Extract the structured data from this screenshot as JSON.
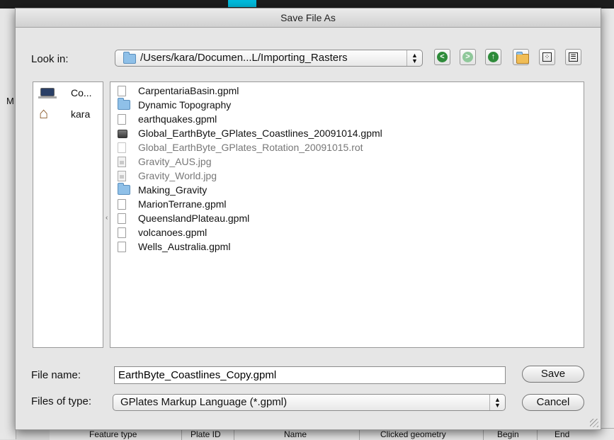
{
  "dialog": {
    "title": "Save File As",
    "look_in_label": "Look in:",
    "look_in_path": "/Users/kara/Documen...L/Importing_Rasters",
    "toolbar": [
      {
        "name": "back-icon",
        "color": "#2e8b3a"
      },
      {
        "name": "forward-icon",
        "color": "#8fc89a"
      },
      {
        "name": "up-folder-icon",
        "color": "#2e8b3a"
      },
      {
        "name": "new-folder-icon",
        "color": "#e0a23a"
      },
      {
        "name": "list-view-icon",
        "color": "#333333"
      },
      {
        "name": "details-view-icon",
        "color": "#333333"
      }
    ],
    "sidebar": [
      {
        "label": "Co...",
        "icon": "laptop-icon"
      },
      {
        "label": "kara",
        "icon": "home-icon"
      }
    ],
    "files": [
      {
        "name": "CarpentariaBasin.gpml",
        "type": "document",
        "enabled": true
      },
      {
        "name": "Dynamic Topography",
        "type": "folder",
        "enabled": true
      },
      {
        "name": "earthquakes.gpml",
        "type": "document",
        "enabled": true
      },
      {
        "name": "Global_EarthByte_GPlates_Coastlines_20091014.gpml",
        "type": "dark-document",
        "enabled": true
      },
      {
        "name": "Global_EarthByte_GPlates_Rotation_20091015.rot",
        "type": "document",
        "enabled": false
      },
      {
        "name": "Gravity_AUS.jpg",
        "type": "image",
        "enabled": false
      },
      {
        "name": "Gravity_World.jpg",
        "type": "image",
        "enabled": false
      },
      {
        "name": "Making_Gravity",
        "type": "folder",
        "enabled": true
      },
      {
        "name": "MarionTerrane.gpml",
        "type": "document",
        "enabled": true
      },
      {
        "name": "QueenslandPlateau.gpml",
        "type": "document",
        "enabled": true
      },
      {
        "name": "volcanoes.gpml",
        "type": "document",
        "enabled": true
      },
      {
        "name": "Wells_Australia.gpml",
        "type": "document",
        "enabled": true
      }
    ],
    "file_name_label": "File name:",
    "file_name_value": "EarthByte_Coastlines_Copy.gpml",
    "files_of_type_label": "Files of type:",
    "files_of_type_value": "GPlates Markup Language (*.gpml)",
    "save_label": "Save",
    "cancel_label": "Cancel"
  },
  "background": {
    "side_letter": "M",
    "table_headers": [
      "Feature type",
      "Plate ID",
      "Name",
      "Clicked geometry",
      "Begin",
      "End"
    ]
  }
}
